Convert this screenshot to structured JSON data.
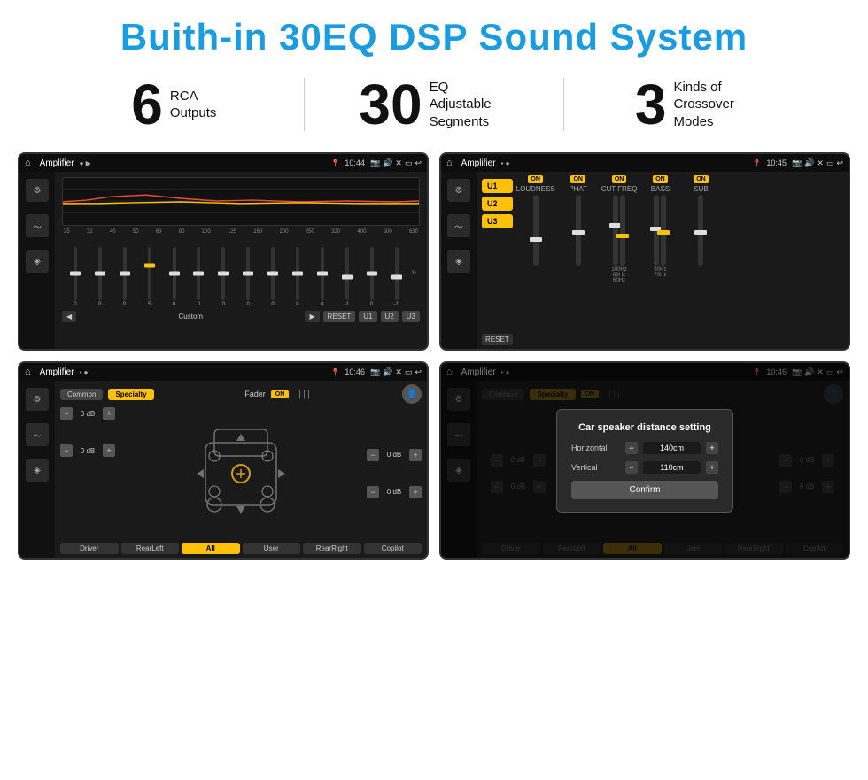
{
  "header": {
    "title": "Buith-in 30EQ DSP Sound System"
  },
  "stats": [
    {
      "number": "6",
      "label": "RCA\nOutputs"
    },
    {
      "number": "30",
      "label": "EQ Adjustable\nSegments"
    },
    {
      "number": "3",
      "label": "Kinds of\nCrossover Modes"
    }
  ],
  "screens": {
    "eq_screen": {
      "app_name": "Amplifier",
      "time": "10:44",
      "freq_labels": [
        "25",
        "32",
        "40",
        "50",
        "63",
        "80",
        "100",
        "125",
        "160",
        "200",
        "250",
        "320",
        "400",
        "500",
        "630"
      ],
      "slider_values": [
        "0",
        "0",
        "0",
        "5",
        "0",
        "0",
        "0",
        "0",
        "0",
        "0",
        "0",
        "-1",
        "0",
        "-1"
      ],
      "mode_label": "Custom",
      "buttons": [
        "RESET",
        "U1",
        "U2",
        "U3"
      ]
    },
    "dsp_screen": {
      "app_name": "Amplifier",
      "time": "10:45",
      "presets": [
        "U1",
        "U2",
        "U3"
      ],
      "channels": [
        "LOUDNESS",
        "PHAT",
        "CUT FREQ",
        "BASS",
        "SUB"
      ],
      "reset_label": "RESET"
    },
    "fader_screen": {
      "app_name": "Amplifier",
      "time": "10:46",
      "tabs": [
        "Common",
        "Specialty"
      ],
      "fader_label": "Fader",
      "on_label": "ON",
      "db_values": [
        "0 dB",
        "0 dB",
        "0 dB",
        "0 dB"
      ],
      "bottom_buttons": [
        "Driver",
        "RearLeft",
        "All",
        "User",
        "RearRight",
        "Copilot"
      ]
    },
    "dialog_screen": {
      "app_name": "Amplifier",
      "time": "10:46",
      "tabs": [
        "Common",
        "Specialty"
      ],
      "dialog_title": "Car speaker distance setting",
      "horizontal_label": "Horizontal",
      "horizontal_value": "140cm",
      "vertical_label": "Vertical",
      "vertical_value": "110cm",
      "confirm_label": "Confirm",
      "bottom_buttons": [
        "Driver",
        "RearLeft",
        "All",
        "User",
        "RearRight",
        "Copilot"
      ]
    }
  },
  "icons": {
    "home": "⌂",
    "back": "↩",
    "expand": "»",
    "play": "▶",
    "prev": "◀",
    "person": "👤",
    "pin": "📍",
    "speaker": "🔊",
    "close": "✕",
    "window": "▭",
    "minus": "−",
    "plus": "+"
  }
}
